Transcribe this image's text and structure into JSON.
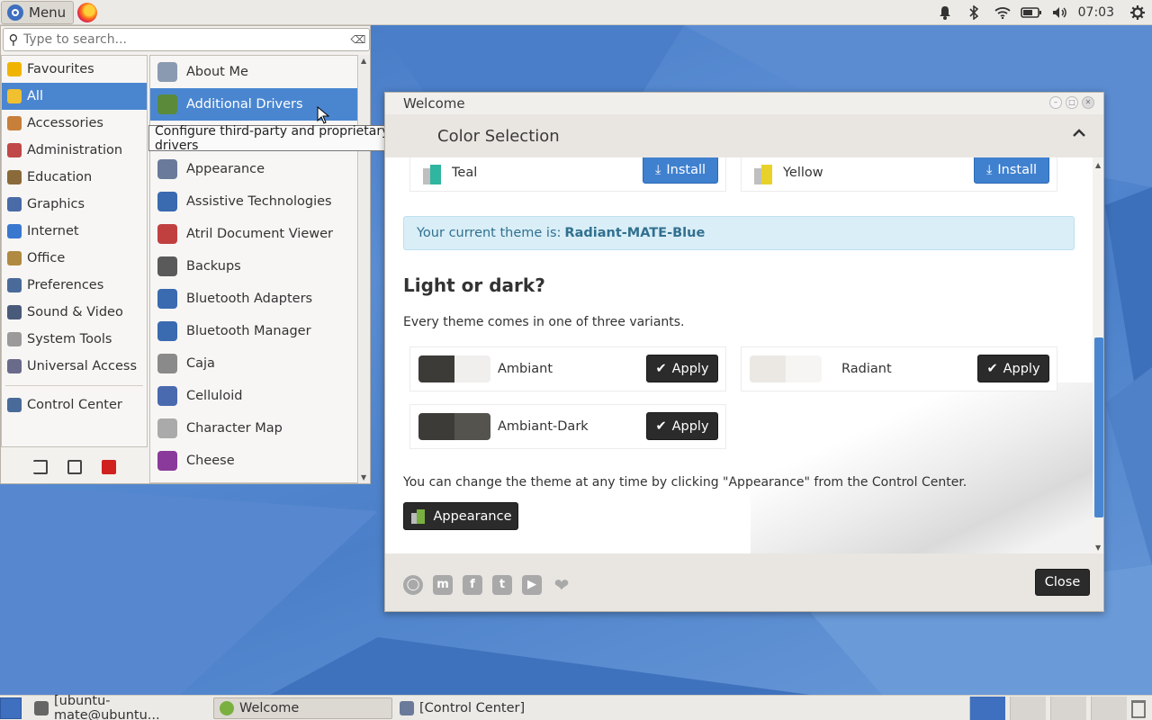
{
  "top_panel": {
    "menu_label": "Menu",
    "clock": "07:03"
  },
  "menu": {
    "search_placeholder": "Type to search...",
    "categories": [
      {
        "label": "Favourites",
        "color": "#f0b400"
      },
      {
        "label": "All",
        "color": "#f0c030",
        "selected": true
      },
      {
        "label": "Accessories",
        "color": "#c87f3a"
      },
      {
        "label": "Administration",
        "color": "#c04848"
      },
      {
        "label": "Education",
        "color": "#8a6a3a"
      },
      {
        "label": "Graphics",
        "color": "#4a6aa8"
      },
      {
        "label": "Internet",
        "color": "#3a78d0"
      },
      {
        "label": "Office",
        "color": "#b08a40"
      },
      {
        "label": "Preferences",
        "color": "#4a6a9a"
      },
      {
        "label": "Sound & Video",
        "color": "#4a5a7a"
      },
      {
        "label": "System Tools",
        "color": "#9a9a9a"
      },
      {
        "label": "Universal Access",
        "color": "#6a6a8a"
      }
    ],
    "control_center": "Control Center",
    "apps": [
      {
        "label": "About Me",
        "color": "#8a9ab0"
      },
      {
        "label": "Additional Drivers",
        "color": "#5a8a3a",
        "selected": true
      },
      {
        "label": "",
        "color": "transparent"
      },
      {
        "label": "Appearance",
        "color": "#6a7a9a"
      },
      {
        "label": "Assistive Technologies",
        "color": "#3a6ab0"
      },
      {
        "label": "Atril Document Viewer",
        "color": "#c04040"
      },
      {
        "label": "Backups",
        "color": "#5a5a5a"
      },
      {
        "label": "Bluetooth Adapters",
        "color": "#3a6ab0"
      },
      {
        "label": "Bluetooth Manager",
        "color": "#3a6ab0"
      },
      {
        "label": "Caja",
        "color": "#8a8a8a"
      },
      {
        "label": "Celluloid",
        "color": "#4a6ab0"
      },
      {
        "label": "Character Map",
        "color": "#aaaaaa"
      },
      {
        "label": "Cheese",
        "color": "#8a3a9a"
      }
    ],
    "tooltip": "Configure third-party and proprietary drivers"
  },
  "welcome": {
    "title": "Welcome",
    "section": "Color Selection",
    "colors": [
      {
        "name": "Teal",
        "button": "Install"
      },
      {
        "name": "Yellow",
        "button": "Install"
      }
    ],
    "current_theme_prefix": "Your current theme is:",
    "current_theme": "Radiant-MATE-Blue",
    "heading": "Light or dark?",
    "variants_text": "Every theme comes in one of three variants.",
    "variants": [
      {
        "name": "Ambiant",
        "button": "Apply"
      },
      {
        "name": "Radiant",
        "button": "Apply"
      },
      {
        "name": "Ambiant-Dark",
        "button": "Apply"
      }
    ],
    "change_text": "You can change the theme at any time by clicking \"Appearance\" from the Control Center.",
    "appearance_button": "Appearance",
    "close_button": "Close"
  },
  "taskbar": {
    "tasks": [
      {
        "label": "[ubuntu-mate@ubuntu..."
      },
      {
        "label": "Welcome"
      },
      {
        "label": "[Control Center]"
      }
    ]
  }
}
